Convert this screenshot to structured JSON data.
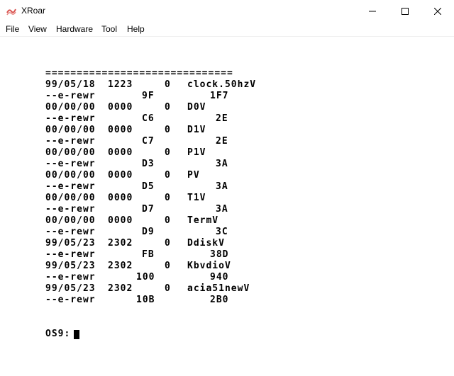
{
  "window": {
    "title": "XRoar"
  },
  "menu": [
    "File",
    "View",
    "Hardware",
    "Tool",
    "Help"
  ],
  "terminal": {
    "separator": "==============================",
    "entries": [
      {
        "date": "99/05/18",
        "time": "1223",
        "owner": "0",
        "name": "clock.50hzV",
        "attrs": "--e-rewr",
        "sector": "9F",
        "size": "1F7"
      },
      {
        "date": "00/00/00",
        "time": "0000",
        "owner": "0",
        "name": "D0V",
        "attrs": "--e-rewr",
        "sector": "C6",
        "size": "2E"
      },
      {
        "date": "00/00/00",
        "time": "0000",
        "owner": "0",
        "name": "D1V",
        "attrs": "--e-rewr",
        "sector": "C7",
        "size": "2E"
      },
      {
        "date": "00/00/00",
        "time": "0000",
        "owner": "0",
        "name": "P1V",
        "attrs": "--e-rewr",
        "sector": "D3",
        "size": "3A"
      },
      {
        "date": "00/00/00",
        "time": "0000",
        "owner": "0",
        "name": "PV",
        "attrs": "--e-rewr",
        "sector": "D5",
        "size": "3A"
      },
      {
        "date": "00/00/00",
        "time": "0000",
        "owner": "0",
        "name": "T1V",
        "attrs": "--e-rewr",
        "sector": "D7",
        "size": "3A"
      },
      {
        "date": "00/00/00",
        "time": "0000",
        "owner": "0",
        "name": "TermV",
        "attrs": "--e-rewr",
        "sector": "D9",
        "size": "3C"
      },
      {
        "date": "99/05/23",
        "time": "2302",
        "owner": "0",
        "name": "DdiskV",
        "attrs": "--e-rewr",
        "sector": "FB",
        "size": "38D"
      },
      {
        "date": "99/05/23",
        "time": "2302",
        "owner": "0",
        "name": "KbvdioV",
        "attrs": "--e-rewr",
        "sector": "100",
        "size": "940"
      },
      {
        "date": "99/05/23",
        "time": "2302",
        "owner": "0",
        "name": "acia51newV",
        "attrs": "--e-rewr",
        "sector": "10B",
        "size": "2B0"
      }
    ],
    "prompt": "OS9:"
  }
}
